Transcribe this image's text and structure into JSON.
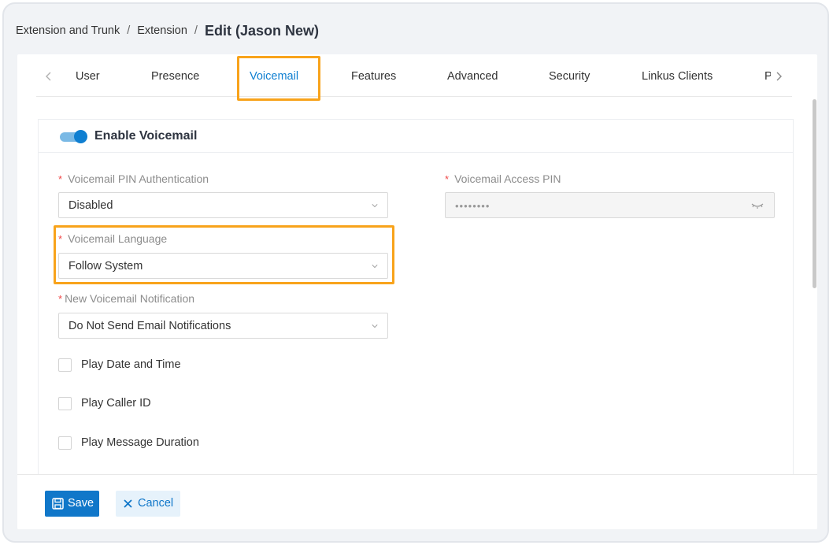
{
  "breadcrumb": {
    "items": [
      "Extension and Trunk",
      "Extension"
    ],
    "separator": "/",
    "current": "Edit (Jason New)"
  },
  "tabs": {
    "items": [
      "User",
      "Presence",
      "Voicemail",
      "Features",
      "Advanced",
      "Security",
      "Linkus Clients",
      "P"
    ],
    "active": "Voicemail",
    "prev_icon": "chevron-left-icon",
    "next_icon": "chevron-right-icon"
  },
  "card": {
    "title": "Enable Voicemail",
    "enabled": true
  },
  "fields": {
    "pin_auth": {
      "label": "Voicemail PIN Authentication",
      "value": "Disabled",
      "required_mark": "*"
    },
    "access_pin": {
      "label": "Voicemail Access PIN",
      "value": "••••••••",
      "required_mark": "*"
    },
    "language": {
      "label": "Voicemail Language",
      "value": "Follow System",
      "required_mark": "*"
    },
    "notification": {
      "label": "New Voicemail Notification",
      "value": "Do Not Send Email Notifications",
      "required_mark": "*"
    }
  },
  "checkboxes": [
    {
      "label": "Play Date and Time",
      "checked": false
    },
    {
      "label": "Play Caller ID",
      "checked": false
    },
    {
      "label": "Play Message Duration",
      "checked": false
    }
  ],
  "footer": {
    "save_label": "Save",
    "cancel_label": "Cancel"
  },
  "colors": {
    "accent": "#0f7fd1",
    "highlight": "#f8a31b",
    "required": "#f04848"
  }
}
